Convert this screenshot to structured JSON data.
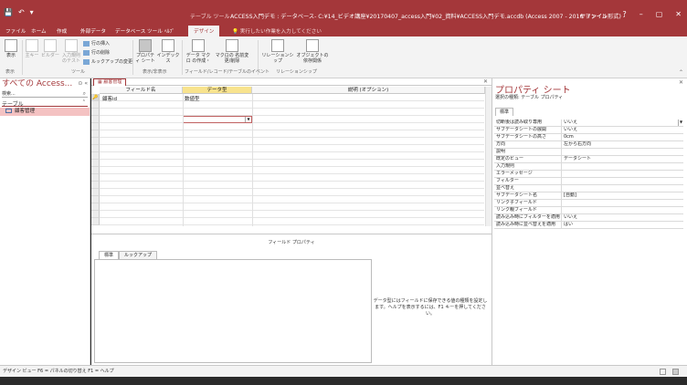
{
  "titlebar": {
    "context_label": "テーブル ツール",
    "title": "ACCESS入門デモ : データベース- C:¥14_ビデオ講座¥20170407_access入門¥02_資料¥ACCESS入門デモ.accdb (Access 2007 - 2016 ファイル形式) -",
    "signin": "サインイン",
    "help": "?",
    "minimize": "–",
    "restore": "▢",
    "close": "✕"
  },
  "tabs": {
    "file": "ファイル",
    "home": "ホーム",
    "create": "作成",
    "external": "外部データ",
    "dbtools": "データベース ツール",
    "help": "ﾍﾙﾌﾟ",
    "design": "デザイン",
    "search": "実行したい作業を入力してください"
  },
  "ribbon": {
    "view": "表示",
    "primary_key": "主キー",
    "builder": "ビルダー",
    "test_rules": "入力規則 のテスト",
    "insert_rows": "行の挿入",
    "delete_rows": "行の削除",
    "lookup_change": "ルックアップの変更",
    "property_sheet": "プロパティ シート",
    "indexes": "インデックス",
    "create_macro": "データ マクロ の作成・",
    "rename_macro": "マクロの 名前変更/削除",
    "relationships": "リレーションシップ",
    "object_deps": "オブジェクトの 依存関係",
    "groups": {
      "view": "表示",
      "tools": "ツール",
      "show_hide": "表示/非表示",
      "field_events": "フィールド/レコード/テーブルのイベント",
      "relationships": "リレーションシップ"
    }
  },
  "nav": {
    "title": "すべての Access...",
    "search_placeholder": "検索...",
    "group": "テーブル",
    "item": "顧客管理"
  },
  "doc": {
    "tab": "顧客管理",
    "columns": [
      "フィールド名",
      "データ型",
      "説明 (オプション)"
    ],
    "rows": [
      {
        "field": "顧客id",
        "type": "数値型"
      }
    ],
    "field_props_label": "フィールド プロパティ",
    "fp_tabs": [
      "標準",
      "ルックアップ"
    ],
    "fp_help": "データ型にはフィールドに保存できる値の種類を設定します。ヘルプを表示するには、F1 キーを押してください。"
  },
  "sheet": {
    "title": "プロパティ シート",
    "type_label": "選択の種類: テーブル プロパティ",
    "tab": "標準",
    "props": [
      {
        "k": "切断後は読み取り専用",
        "v": "いいえ",
        "dd": true
      },
      {
        "k": "サブデータシートの展開",
        "v": "いいえ"
      },
      {
        "k": "サブデータシートの高さ",
        "v": "0cm"
      },
      {
        "k": "方向",
        "v": "左から右方向"
      },
      {
        "k": "説明",
        "v": ""
      },
      {
        "k": "既定のビュー",
        "v": "データシート"
      },
      {
        "k": "入力規則",
        "v": ""
      },
      {
        "k": "エラーメッセージ",
        "v": ""
      },
      {
        "k": "フィルター",
        "v": ""
      },
      {
        "k": "並べ替え",
        "v": ""
      },
      {
        "k": "サブデータシート名",
        "v": "[自動]"
      },
      {
        "k": "リンク子フィールド",
        "v": ""
      },
      {
        "k": "リンク親フィールド",
        "v": ""
      },
      {
        "k": "読み込み時にフィルターを適用",
        "v": "いいえ"
      },
      {
        "k": "読み込み時に並べ替えを適用",
        "v": "はい"
      }
    ]
  },
  "status": {
    "text": "デザイン ビュー F6 = パネルの切り替え F1 = ヘルプ"
  }
}
